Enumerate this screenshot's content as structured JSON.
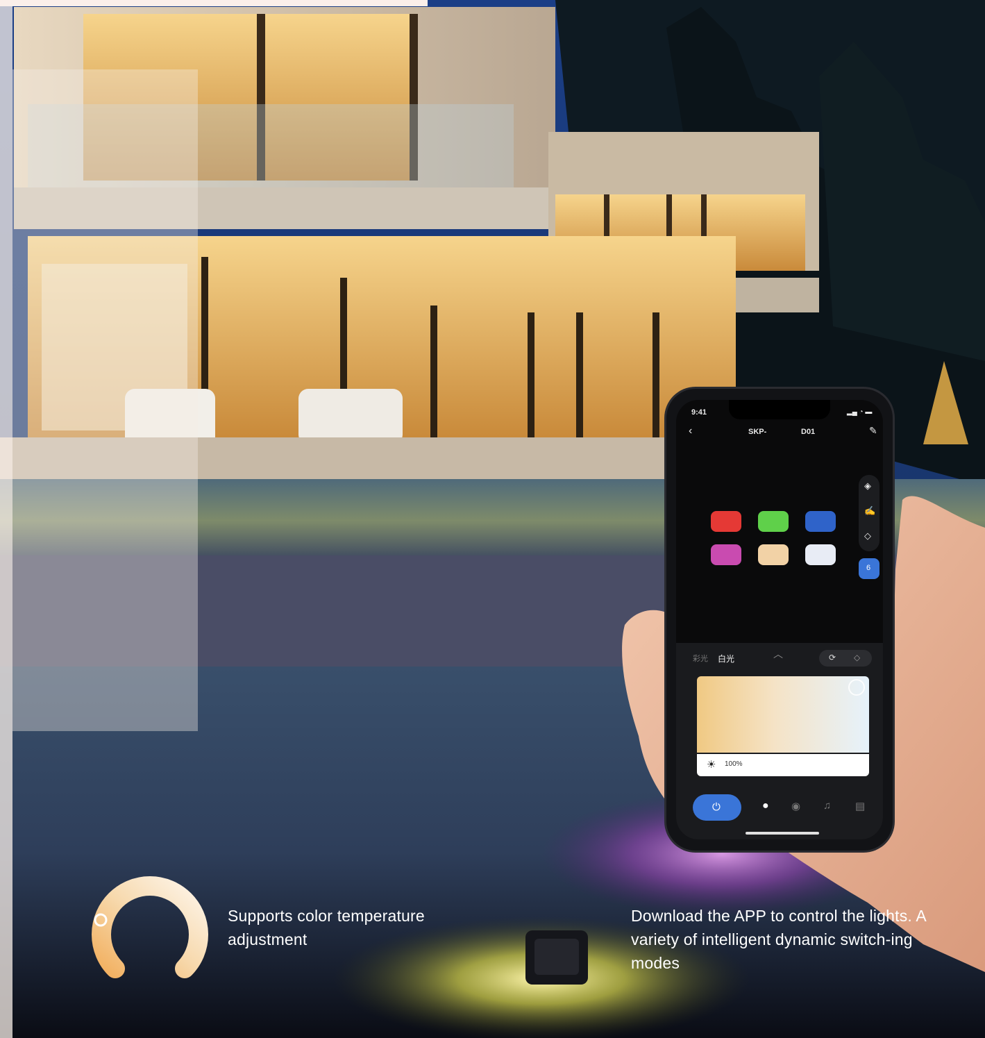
{
  "captions": {
    "color_temperature": "Supports color temperature adjustment",
    "app_control": "Download the APP to control the lights. A variety of intelligent dynamic switch-ing modes"
  },
  "phone": {
    "status_time": "9:41",
    "device_name_left": "SKP-",
    "device_name_right": "D01",
    "tab_color": "彩光",
    "tab_white": "白光",
    "brightness": "100%",
    "badge_count": "6",
    "swatches": [
      "#e53935",
      "#5fd04a",
      "#2f63c9",
      "#c94bb0",
      "#f2d2a6",
      "#e8ecf5"
    ],
    "icons": [
      "back-icon",
      "edit-icon",
      "paint-bucket-icon",
      "brush-icon",
      "eraser-icon",
      "power-icon",
      "bulb-icon",
      "palette-icon",
      "music-icon",
      "schedule-icon",
      "sun-icon",
      "chevron-down-icon",
      "refresh-icon",
      "tag-icon"
    ]
  },
  "colors": {
    "accent_blue": "#3a75d8",
    "warm_light": "#f5c98a",
    "cool_light": "#e6f2fb"
  }
}
